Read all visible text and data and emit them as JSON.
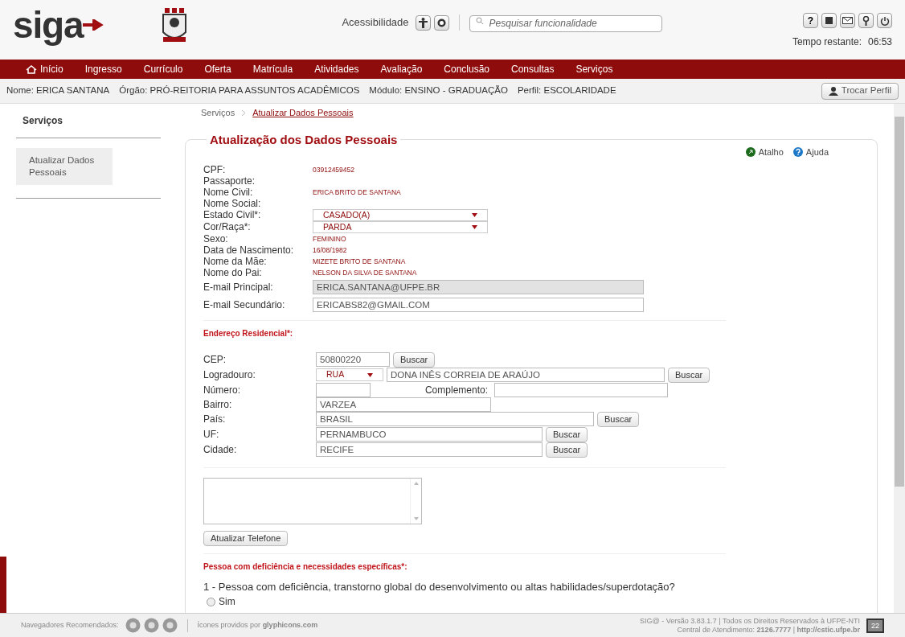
{
  "header": {
    "logo": "siga",
    "accessibility_label": "Acessibilidade",
    "search": {
      "placeholder": "Pesquisar funcionalidade"
    },
    "help_icon": "?",
    "time_label": "Tempo restante:",
    "time_value": "06:53"
  },
  "nav": {
    "items": [
      {
        "label": "Início",
        "selected": false
      },
      {
        "label": "Ingresso",
        "selected": false
      },
      {
        "label": "Currículo",
        "selected": false
      },
      {
        "label": "Oferta",
        "selected": false
      },
      {
        "label": "Matrícula",
        "selected": false
      },
      {
        "label": "Atividades",
        "selected": false
      },
      {
        "label": "Avaliação",
        "selected": false
      },
      {
        "label": "Conclusão",
        "selected": false
      },
      {
        "label": "Consultas",
        "selected": false
      },
      {
        "label": "Serviços",
        "selected": false
      }
    ]
  },
  "user_bar": {
    "items": [
      "Nome: ERICA SANTANA",
      "Órgão: PRÓ-REITORIA PARA ASSUNTOS ACADÊMICOS",
      "Módulo: ENSINO - GRADUAÇÃO",
      "Perfil: ESCOLARIDADE"
    ],
    "button": "Trocar Perfil"
  },
  "sidebar": {
    "title": "Serviços",
    "items": [
      {
        "label": "Atualizar Dados Pessoais",
        "selected": true
      }
    ]
  },
  "breadcrumb": [
    "Serviços",
    "Atualizar Dados Pessoais"
  ],
  "form": {
    "title": "Atualização dos Dados Pessoais",
    "links": [
      "Atalho",
      "Ajuda"
    ],
    "personal": [
      {
        "label": "CPF:",
        "kind": "text",
        "value": "03912459452"
      },
      {
        "label": "Passaporte:",
        "kind": "text"
      },
      {
        "label": "Nome Civil:",
        "kind": "text",
        "value": "ERICA BRITO DE SANTANA"
      },
      {
        "label": "Nome Social:",
        "kind": "text"
      },
      {
        "label": "Estado Civil*:",
        "kind": "select",
        "value": "CASADO(A)"
      },
      {
        "label": "Cor/Raça*:",
        "kind": "select",
        "value": "PARDA"
      },
      {
        "label": "Sexo:",
        "kind": "text",
        "value": "FEMININO"
      },
      {
        "label": "Data de Nascimento:",
        "kind": "text",
        "value": "16/08/1982"
      },
      {
        "label": "Nome da Mãe:",
        "kind": "text",
        "value": "MIZETE BRITO DE SANTANA"
      },
      {
        "label": "Nome do Pai:",
        "kind": "text",
        "value": "NELSON DA SILVA DE SANTANA"
      },
      {
        "label": "E-mail Principal:",
        "kind": "input",
        "value": "ERICA.SANTANA@UFPE.BR",
        "disabled": true
      },
      {
        "label": "E-mail Secundário:",
        "kind": "input",
        "value": "ERICABS82@GMAIL.COM",
        "disabled": false
      }
    ],
    "address_title": "Endereço Residencial*:",
    "address": {
      "cep": {
        "label": "CEP:",
        "value": "50800220",
        "button": "Buscar"
      },
      "logradouro": {
        "label": "Logradouro:",
        "type": "RUA",
        "value": "DONA INÊS CORREIA DE ARAÚJO",
        "button": "Buscar"
      },
      "numero": {
        "label": "Número:",
        "complemento_label": "Complemento:"
      },
      "bairro": {
        "label": "Bairro:",
        "value": "VARZEA"
      },
      "pais": {
        "label": "País:",
        "value": "BRASIL",
        "button": "Buscar"
      },
      "uf": {
        "label": "UF:",
        "value": "PERNAMBUCO",
        "button": "Buscar"
      },
      "cidade": {
        "label": "Cidade:",
        "value": "RECIFE",
        "button": "Buscar"
      }
    },
    "phone_button": "Atualizar Telefone",
    "disability_title": "Pessoa com deficiência e necessidades específicas*:",
    "question": "1 - Pessoa com deficiência, transtorno global do desenvolvimento ou altas habilidades/superdotação?",
    "options": [
      {
        "label": "Sim",
        "selected": false
      }
    ]
  },
  "footer": {
    "browsers_label": "Navegadores Recomendados:",
    "icons_credit": "Ícones providos por **glyphicons.com**",
    "version": "SIG@ - Versão 3.83.1.7 | Todos os Direitos Reservados à UFPE-NTI",
    "contact": "Central de Atendimento: **2126.7777** | **http://cstic.ufpe.br**",
    "badge": "22"
  }
}
